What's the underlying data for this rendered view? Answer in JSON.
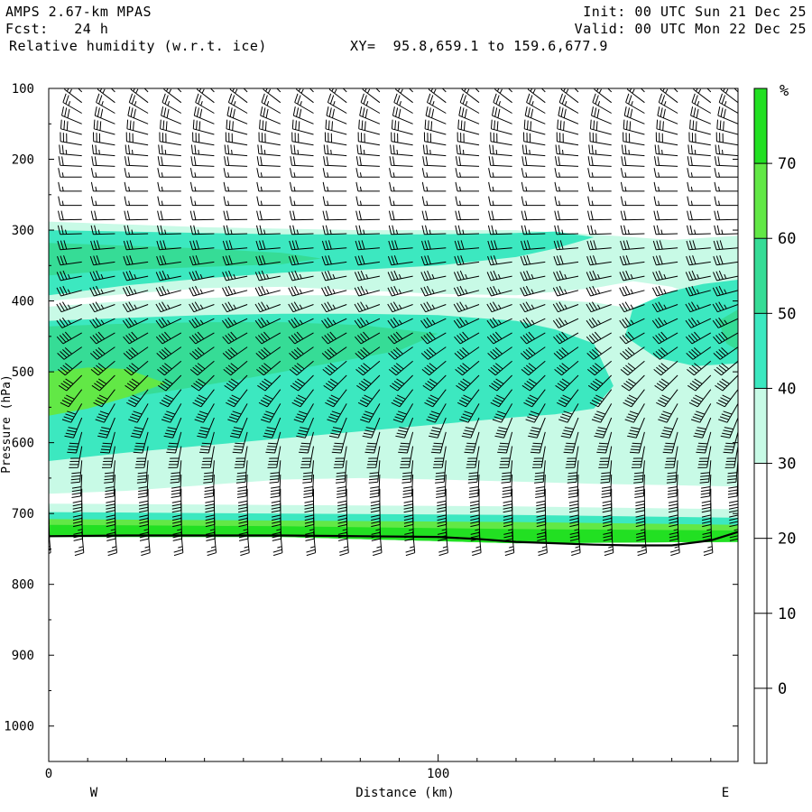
{
  "header": {
    "model": "AMPS 2.67-km MPAS",
    "fcst_label": "Fcst:",
    "fcst_value": "24 h",
    "field": "Relative humidity (w.r.t. ice)",
    "xy": "XY=  95.8,659.1 to 159.6,677.9",
    "init": "Init: 00 UTC Sun 21 Dec 25",
    "valid": "Valid: 00 UTC Mon 22 Dec 25"
  },
  "chart_data": {
    "type": "heatmap",
    "title": "Relative humidity (w.r.t. ice)",
    "xlabel": "Distance (km)",
    "ylabel": "Pressure (hPa)",
    "x_ticks": [
      0,
      100
    ],
    "x_ticks_text": [
      "0",
      "100"
    ],
    "x_range": [
      0,
      177
    ],
    "y_ticks": [
      100,
      200,
      300,
      400,
      500,
      600,
      700,
      800,
      900,
      1000
    ],
    "y_ticks_text": [
      "100",
      "200",
      "300",
      "400",
      "500",
      "600",
      "700",
      "800",
      "900",
      "1000"
    ],
    "y_range": [
      100,
      1050
    ],
    "y_inverted": true,
    "left_end_label": "W",
    "right_end_label": "E",
    "colorbar": {
      "unit": "%",
      "levels": [
        -10,
        0,
        10,
        20,
        30,
        40,
        50,
        60,
        70,
        80
      ],
      "tick_labels": [
        "0",
        "10",
        "20",
        "30",
        "40",
        "50",
        "60",
        "70"
      ],
      "tick_values": [
        0,
        10,
        20,
        30,
        40,
        50,
        60,
        70
      ],
      "colors": [
        "#ffffff",
        "#ffffff",
        "#ffffff",
        "#ffffff",
        "#c8fae6",
        "#3ce8c0",
        "#36dc96",
        "#62e846",
        "#22e022"
      ]
    },
    "terrain_pressure": {
      "x": [
        0,
        20,
        40,
        60,
        80,
        100,
        110,
        120,
        130,
        140,
        150,
        160,
        170,
        177
      ],
      "p": [
        732,
        731,
        731,
        731,
        732,
        733,
        736,
        740,
        742,
        744,
        745,
        745,
        738,
        726
      ]
    },
    "rh_regions": [
      {
        "name": "upper-moist-layer-30",
        "level": 30,
        "x": [
          0,
          20,
          40,
          60,
          80,
          100,
          120,
          140,
          160,
          177,
          177,
          170,
          160,
          150,
          140,
          120,
          100,
          80,
          60,
          40,
          20,
          0
        ],
        "p": [
          288,
          292,
          296,
          298,
          300,
          300,
          300,
          306,
          314,
          308,
          400,
          400,
          380,
          372,
          382,
          392,
          390,
          385,
          380,
          382,
          390,
          400
        ]
      },
      {
        "name": "upper-moist-layer-40",
        "level": 40,
        "x": [
          0,
          20,
          40,
          60,
          80,
          100,
          120,
          130,
          140,
          130,
          120,
          100,
          80,
          60,
          40,
          20,
          0
        ],
        "p": [
          300,
          302,
          304,
          306,
          306,
          306,
          304,
          302,
          310,
          326,
          338,
          350,
          356,
          360,
          368,
          378,
          392
        ]
      },
      {
        "name": "upper-moist-layer-50",
        "level": 50,
        "x": [
          0,
          20,
          40,
          60,
          70,
          60,
          40,
          20,
          0
        ],
        "p": [
          318,
          322,
          326,
          332,
          340,
          348,
          352,
          356,
          364
        ]
      },
      {
        "name": "mid-moist-layer-30",
        "level": 30,
        "x": [
          0,
          20,
          40,
          60,
          80,
          100,
          120,
          140,
          160,
          177,
          177,
          160,
          140,
          120,
          100,
          80,
          60,
          40,
          20,
          0
        ],
        "p": [
          408,
          400,
          396,
          392,
          392,
          394,
          396,
          402,
          420,
          450,
          662,
          660,
          658,
          655,
          652,
          650,
          652,
          660,
          668,
          672
        ]
      },
      {
        "name": "mid-moist-layer-40",
        "level": 40,
        "x": [
          0,
          20,
          40,
          60,
          80,
          100,
          120,
          130,
          140,
          145,
          140,
          130,
          120,
          100,
          80,
          60,
          40,
          20,
          0
        ],
        "p": [
          428,
          424,
          420,
          418,
          418,
          420,
          428,
          440,
          460,
          520,
          552,
          560,
          564,
          574,
          584,
          594,
          604,
          614,
          626
        ]
      },
      {
        "name": "mid-moist-layer-50",
        "level": 50,
        "x": [
          0,
          20,
          40,
          60,
          80,
          100,
          90,
          70,
          50,
          30,
          10,
          0
        ],
        "p": [
          436,
          432,
          430,
          430,
          434,
          446,
          470,
          490,
          510,
          528,
          544,
          548
        ]
      },
      {
        "name": "mid-moist-layer-60",
        "level": 60,
        "x": [
          0,
          10,
          20,
          30,
          20,
          10,
          0
        ],
        "p": [
          500,
          494,
          496,
          516,
          536,
          552,
          562
        ]
      },
      {
        "name": "east-moist-layer-40",
        "level": 40,
        "x": [
          177,
          168,
          160,
          150,
          148,
          156,
          166,
          177
        ],
        "p": [
          370,
          376,
          386,
          410,
          450,
          480,
          492,
          488
        ]
      },
      {
        "name": "east-moist-layer-50",
        "level": 50,
        "x": [
          177,
          172,
          174,
          177
        ],
        "p": [
          412,
          428,
          460,
          470
        ]
      },
      {
        "name": "near-surface-layer-30",
        "level": 30,
        "x": [
          0,
          60,
          120,
          177,
          177,
          120,
          60,
          0
        ],
        "p": [
          686,
          688,
          690,
          694,
          740,
          742,
          733,
          733
        ]
      },
      {
        "name": "near-surface-layer-40",
        "level": 40,
        "x": [
          0,
          60,
          120,
          177,
          177,
          120,
          60,
          0
        ],
        "p": [
          698,
          700,
          702,
          706,
          740,
          742,
          733,
          733
        ]
      },
      {
        "name": "near-surface-layer-60",
        "level": 60,
        "x": [
          0,
          60,
          120,
          177,
          177,
          120,
          60,
          0
        ],
        "p": [
          708,
          710,
          712,
          716,
          740,
          742,
          733,
          733
        ]
      },
      {
        "name": "near-surface-layer-70",
        "level": 70,
        "x": [
          0,
          60,
          120,
          177,
          177,
          120,
          60,
          0
        ],
        "p": [
          716,
          718,
          722,
          724,
          740,
          742,
          733,
          733
        ]
      }
    ],
    "wind_barbs": {
      "columns_x": [
        0,
        8.5,
        17,
        25.5,
        34,
        42.5,
        51,
        59.5,
        68,
        76.5,
        85,
        93.5,
        102,
        110.5,
        119,
        127.5,
        136,
        144.5,
        153,
        161.5,
        170,
        177
      ],
      "levels_p": [
        105,
        120,
        135,
        150,
        165,
        180,
        195,
        210,
        225,
        245,
        265,
        285,
        305,
        325,
        345,
        365,
        385,
        405,
        425,
        445,
        465,
        485,
        505,
        525,
        545,
        565,
        585,
        605,
        625,
        645,
        665,
        685,
        705,
        725
      ],
      "profile": [
        {
          "p": 105,
          "dir": 315,
          "kt": 20
        },
        {
          "p": 135,
          "dir": 300,
          "kt": 25
        },
        {
          "p": 165,
          "dir": 285,
          "kt": 30
        },
        {
          "p": 195,
          "dir": 275,
          "kt": 25
        },
        {
          "p": 225,
          "dir": 270,
          "kt": 15
        },
        {
          "p": 265,
          "dir": 270,
          "kt": 15
        },
        {
          "p": 305,
          "dir": 268,
          "kt": 25
        },
        {
          "p": 345,
          "dir": 262,
          "kt": 30
        },
        {
          "p": 385,
          "dir": 255,
          "kt": 35
        },
        {
          "p": 425,
          "dir": 245,
          "kt": 35
        },
        {
          "p": 465,
          "dir": 235,
          "kt": 40
        },
        {
          "p": 505,
          "dir": 225,
          "kt": 40
        },
        {
          "p": 545,
          "dir": 210,
          "kt": 40
        },
        {
          "p": 585,
          "dir": 195,
          "kt": 40
        },
        {
          "p": 625,
          "dir": 185,
          "kt": 40
        },
        {
          "p": 665,
          "dir": 180,
          "kt": 40
        },
        {
          "p": 705,
          "dir": 178,
          "kt": 35
        },
        {
          "p": 725,
          "dir": 175,
          "kt": 25
        }
      ]
    }
  }
}
